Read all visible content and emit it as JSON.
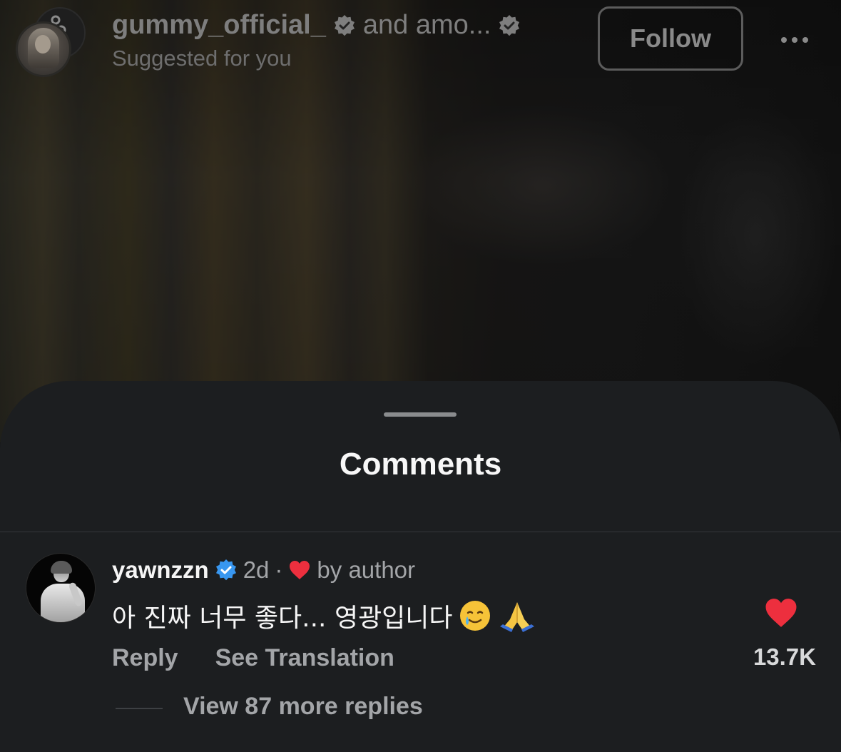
{
  "header": {
    "primary_account": "gummy_official_",
    "coauthor_text": "and amo...",
    "subtitle": "Suggested for you",
    "follow_label": "Follow"
  },
  "comments_sheet": {
    "title": "Comments",
    "comment": {
      "username": "yawnzzn",
      "age": "2d",
      "separator": "·",
      "liked_by_author_text": "by author",
      "text": "아 진짜 너무 좋다... 영광입니다",
      "emojis": [
        "smiling-face-with-tear",
        "folded-hands"
      ],
      "reply_label": "Reply",
      "translation_label": "See Translation",
      "like_count": "13.7K",
      "view_replies_label": "View 87 more replies",
      "liked": true
    }
  },
  "colors": {
    "sheet_background": "#1c1e20",
    "like_red": "#ed2f3e",
    "verified_blue": "#3897f0",
    "secondary_text": "#a3a5a8"
  }
}
